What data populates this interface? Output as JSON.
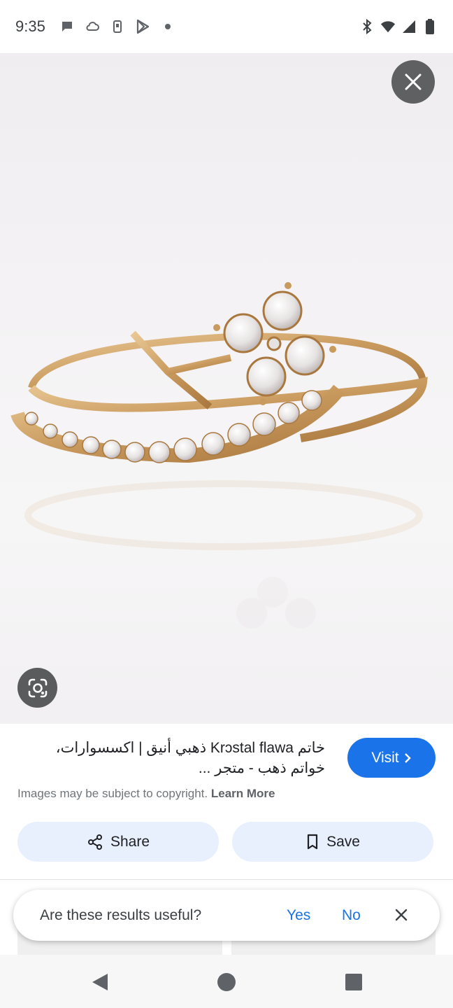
{
  "status_bar": {
    "time": "9:35",
    "left_icons": [
      "chat-bubble-icon",
      "cloud-icon",
      "phone-icon",
      "play-store-icon",
      "dot-icon"
    ],
    "right_icons": [
      "bluetooth-icon",
      "wifi-icon",
      "signal-icon",
      "battery-icon"
    ]
  },
  "viewer": {
    "close_icon": "close-icon",
    "lens_icon": "google-lens-icon"
  },
  "result": {
    "title": "خاتم Krɔstal flawa ذهبي أنيق | اكسسوارات، خواتم ذهب - متجر ...",
    "visit_label": "Visit",
    "copyright_text": "Images may be subject to copyright.",
    "learn_more": "Learn More",
    "share_label": "Share",
    "save_label": "Save"
  },
  "feedback": {
    "question": "Are these results useful?",
    "yes": "Yes",
    "no": "No"
  },
  "colors": {
    "accent": "#1a73e8",
    "button_bg": "#e8f0fe",
    "overlay_btn": "#5f6061"
  }
}
